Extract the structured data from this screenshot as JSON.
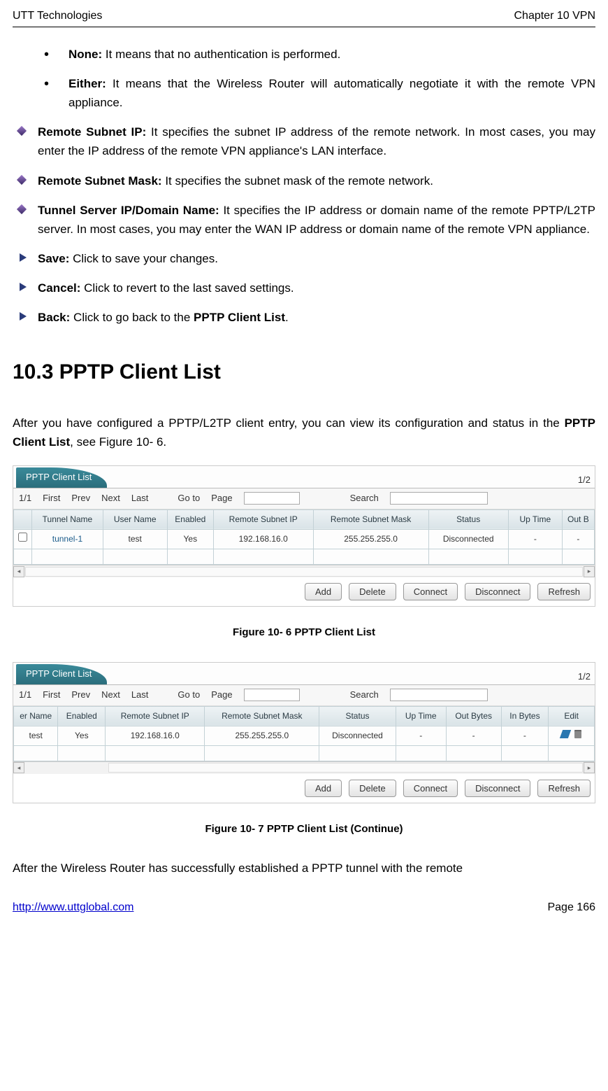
{
  "header": {
    "left": "UTT Technologies",
    "right": "Chapter 10 VPN"
  },
  "bullets": [
    {
      "label": "None:",
      "text": " It means that no authentication is performed."
    },
    {
      "label": "Either:",
      "text": " It means that the Wireless Router will automatically negotiate it with the remote VPN appliance."
    }
  ],
  "diamonds": [
    {
      "label": "Remote Subnet IP:",
      "text": " It specifies the subnet IP address of the remote network. In most cases, you may enter the IP address of the remote VPN appliance's LAN interface."
    },
    {
      "label": "Remote Subnet Mask:",
      "text": " It specifies the subnet mask of the remote network."
    },
    {
      "label": "Tunnel Server IP/Domain Name:",
      "text": " It specifies the IP address or domain name of the remote PPTP/L2TP server. In most cases, you may enter the WAN IP address or domain name of the remote VPN appliance."
    }
  ],
  "arrows": [
    {
      "label": "Save:",
      "text": " Click to save your changes."
    },
    {
      "label": "Cancel:",
      "text": " Click to revert to the last saved settings."
    },
    {
      "label": "Back:",
      "text_before": " Click to go back to the ",
      "bold": "PPTP Client List",
      "text_after": "."
    }
  ],
  "section": {
    "heading": "10.3   PPTP Client List",
    "intro_before": "After you have configured a PPTP/L2TP client entry, you can view its configuration and status in the ",
    "intro_bold": "PPTP Client List",
    "intro_after": ", see Figure 10- 6."
  },
  "panel_common": {
    "tab": "PPTP Client List",
    "counter": "1/2",
    "pager": {
      "page": "1/1",
      "first": "First",
      "prev": "Prev",
      "next": "Next",
      "last": "Last",
      "goto": "Go to",
      "page_label": "Page",
      "search": "Search"
    },
    "buttons": {
      "add": "Add",
      "delete": "Delete",
      "connect": "Connect",
      "disconnect": "Disconnect",
      "refresh": "Refresh"
    }
  },
  "panel1": {
    "headers": [
      "",
      "Tunnel Name",
      "User Name",
      "Enabled",
      "Remote Subnet IP",
      "Remote Subnet Mask",
      "Status",
      "Up Time",
      "Out B"
    ],
    "row": {
      "tunnel": "tunnel-1",
      "user": "test",
      "enabled": "Yes",
      "rsip": "192.168.16.0",
      "rsmask": "255.255.255.0",
      "status": "Disconnected",
      "uptime": "-",
      "out": "-"
    }
  },
  "caption1": "Figure 10- 6 PPTP Client List",
  "panel2": {
    "headers": [
      "er Name",
      "Enabled",
      "Remote Subnet IP",
      "Remote Subnet Mask",
      "Status",
      "Up Time",
      "Out Bytes",
      "In Bytes",
      "Edit"
    ],
    "row": {
      "user": "test",
      "enabled": "Yes",
      "rsip": "192.168.16.0",
      "rsmask": "255.255.255.0",
      "status": "Disconnected",
      "uptime": "-",
      "out": "-",
      "in": "-"
    }
  },
  "caption2": "Figure 10- 7 PPTP Client List (Continue)",
  "closing": "After the Wireless Router has successfully established a PPTP tunnel with the remote",
  "footer": {
    "url": "http://www.uttglobal.com",
    "page": "Page 166"
  }
}
